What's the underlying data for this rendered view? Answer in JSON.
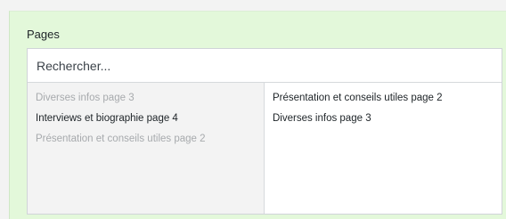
{
  "section": {
    "title": "Pages"
  },
  "search": {
    "placeholder": "Rechercher..."
  },
  "available": {
    "items": [
      {
        "label": "Diverses infos page 3",
        "state": "muted"
      },
      {
        "label": "Interviews et biographie page 4",
        "state": "active"
      },
      {
        "label": "Présentation et conseils utiles page 2",
        "state": "muted"
      }
    ]
  },
  "selected": {
    "items": [
      {
        "label": "Présentation et conseils utiles page 2"
      },
      {
        "label": "Diverses infos page 3"
      }
    ]
  }
}
